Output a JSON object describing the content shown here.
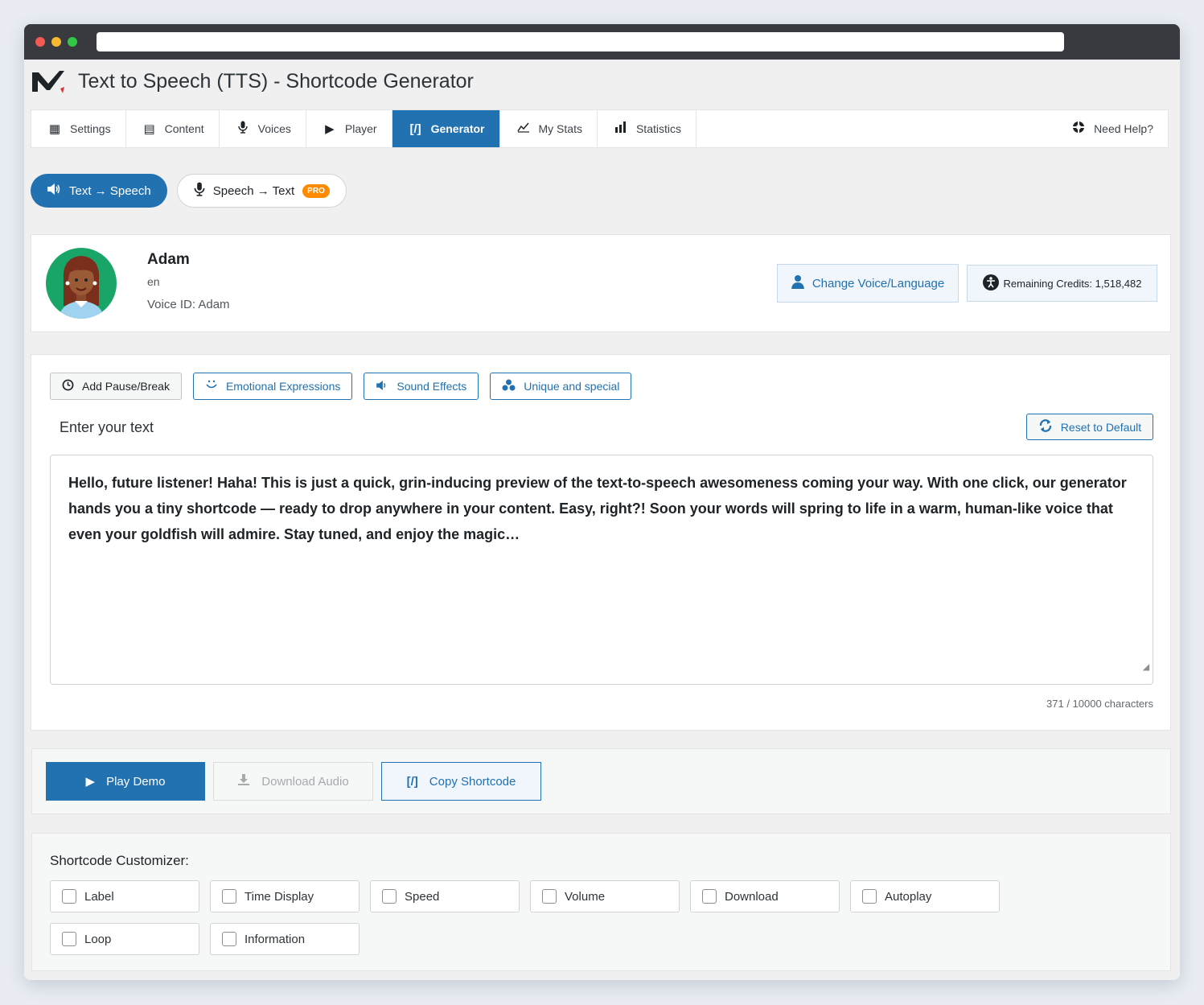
{
  "app": {
    "title": "Text to Speech (TTS) - Shortcode Generator"
  },
  "tabs": [
    {
      "label": "Settings",
      "icon": "settings-grid-icon"
    },
    {
      "label": "Content",
      "icon": "document-icon"
    },
    {
      "label": "Voices",
      "icon": "microphone-icon"
    },
    {
      "label": "Player",
      "icon": "play-icon"
    },
    {
      "label": "Generator",
      "icon": "shortcode-icon",
      "active": true
    },
    {
      "label": "My Stats",
      "icon": "line-chart-icon"
    },
    {
      "label": "Statistics",
      "icon": "bar-chart-icon"
    }
  ],
  "help": {
    "label": "Need Help?",
    "icon": "lifebuoy-icon"
  },
  "modes": {
    "tts": "Text → Speech",
    "stt": "Speech → Text",
    "pro_badge": "PRO"
  },
  "voice": {
    "name": "Adam",
    "language": "en",
    "voice_id": "Voice ID: Adam",
    "change_label": "Change Voice/Language",
    "credits_label": "Remaining Credits: 1,518,482"
  },
  "editor": {
    "tools": {
      "pause": "Add Pause/Break",
      "emotion": "Emotional Expressions",
      "sound": "Sound Effects",
      "unique": "Unique and special"
    },
    "label": "Enter your text",
    "reset": "Reset to Default",
    "text": "Hello, future listener! Haha! This is just a quick, grin-inducing preview of the text-to-speech awesomeness coming your way. With one click, our generator hands you a tiny shortcode — ready to drop anywhere in your content. Easy, right?! Soon your words will spring to life in a warm, human-like voice that even your goldfish will admire. Stay tuned, and enjoy the magic…",
    "char_count": "371 / 10000 characters"
  },
  "actions": {
    "play": "Play Demo",
    "download": "Download Audio",
    "copy": "Copy Shortcode"
  },
  "customizer": {
    "title": "Shortcode Customizer:",
    "options": [
      "Label",
      "Time Display",
      "Speed",
      "Volume",
      "Download",
      "Autoplay",
      "Loop",
      "Information"
    ]
  },
  "colors": {
    "accent": "#2271b1",
    "pro_badge": "#ff8a00"
  }
}
